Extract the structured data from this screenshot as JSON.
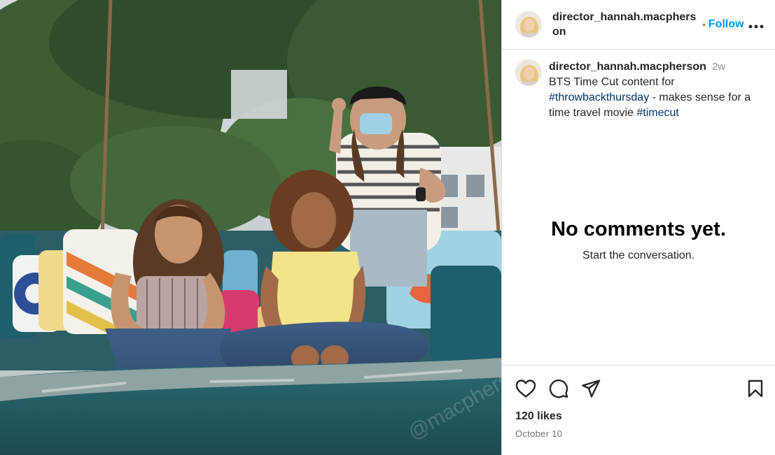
{
  "post": {
    "username": "director_hannah.macpherson",
    "follow_label": "Follow",
    "separator": "•",
    "more_label": "•••",
    "caption": {
      "username": "director_hannah.macpherson",
      "time_ago": "2w",
      "text_1": "BTS Time Cut content for ",
      "hashtag_1": "#throwbackthursday",
      "text_2": " - makes sense for a time travel movie ",
      "hashtag_2": "#timecut"
    },
    "empty_state": {
      "title": "No comments yet.",
      "subtitle": "Start the conversation."
    },
    "likes": "120 likes",
    "date": "October 10"
  },
  "photo": {
    "watermark": "@macpherson"
  },
  "icons": {
    "like": "heart-icon",
    "comment": "comment-icon",
    "share": "share-icon",
    "save": "bookmark-icon",
    "more": "more-icon"
  },
  "colors": {
    "accent": "#0095f6",
    "hashtag": "#00376b",
    "border": "#dbdbdb",
    "muted": "#8e8e8e"
  }
}
